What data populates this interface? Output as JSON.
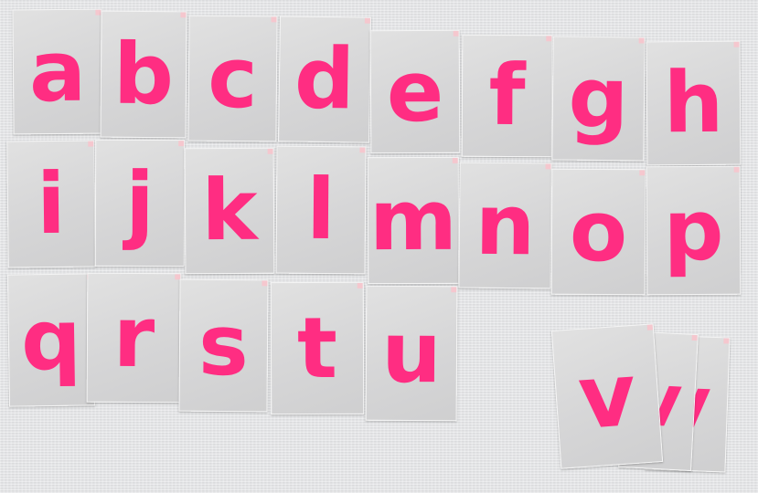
{
  "letters": {
    "a": "a",
    "b": "b",
    "c": "c",
    "d": "d",
    "e": "e",
    "f": "f",
    "g": "g",
    "h": "h",
    "i": "i",
    "j": "j",
    "k": "k",
    "l": "l",
    "m": "m",
    "n": "n",
    "o": "o",
    "p": "p",
    "q": "q",
    "r": "r",
    "s": "s",
    "t": "t",
    "u": "u",
    "v": "v",
    "v_back": "v",
    "v_back2": "v"
  },
  "colors": {
    "letter": "#ff2d82",
    "card": "#dadada",
    "background": "#e4e5e7"
  }
}
